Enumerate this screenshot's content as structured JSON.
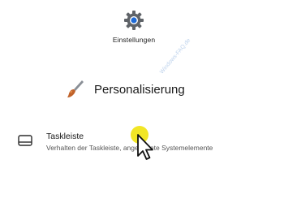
{
  "app": {
    "label": "Einstellungen",
    "icon": "gear-icon"
  },
  "personalization": {
    "label": "Personalisierung",
    "icon": "brush-icon"
  },
  "taskbar": {
    "title": "Taskleiste",
    "description": "Verhalten der Taskleiste, angeheftete Systemelemente",
    "icon": "taskbar-icon"
  },
  "watermark": {
    "text": "Windows-FAQ.de"
  },
  "pointer": {
    "icon": "mouse-pointer-icon",
    "highlight_color": "#f0e200"
  },
  "colors": {
    "gear_outer": "#5f6368",
    "gear_center": "#1e6ad6",
    "brush_bristles": "#c0622a",
    "brush_handle": "#8a8f96"
  }
}
